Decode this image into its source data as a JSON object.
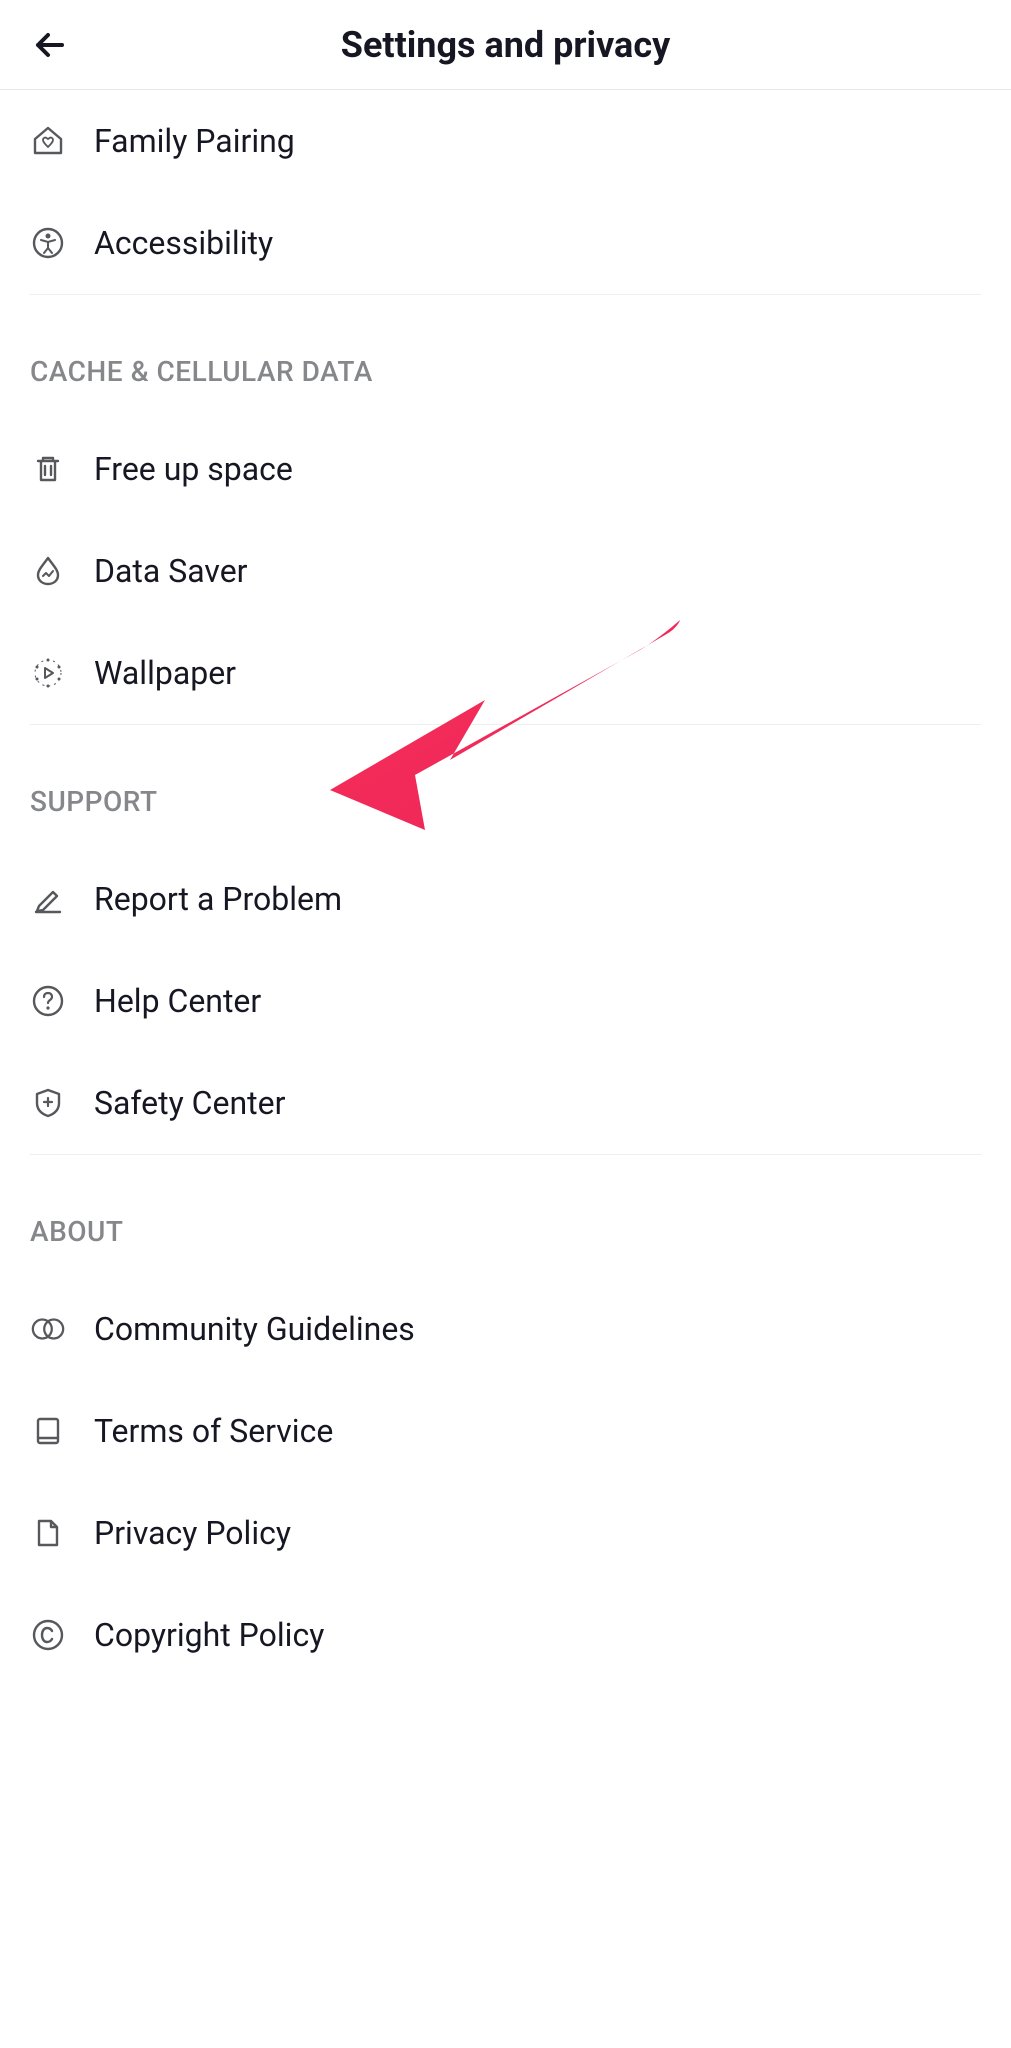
{
  "header": {
    "title": "Settings and privacy"
  },
  "sections": {
    "top": {
      "items": [
        {
          "label": "Family Pairing",
          "icon": "home-heart-icon"
        },
        {
          "label": "Accessibility",
          "icon": "accessibility-icon"
        }
      ]
    },
    "cache": {
      "title": "CACHE & CELLULAR DATA",
      "items": [
        {
          "label": "Free up space",
          "icon": "trash-icon"
        },
        {
          "label": "Data Saver",
          "icon": "water-drop-icon"
        },
        {
          "label": "Wallpaper",
          "icon": "dots-play-icon"
        }
      ]
    },
    "support": {
      "title": "SUPPORT",
      "items": [
        {
          "label": "Report a Problem",
          "icon": "pencil-icon"
        },
        {
          "label": "Help Center",
          "icon": "question-circle-icon"
        },
        {
          "label": "Safety Center",
          "icon": "shield-plus-icon"
        }
      ]
    },
    "about": {
      "title": "ABOUT",
      "items": [
        {
          "label": "Community Guidelines",
          "icon": "circles-overlap-icon"
        },
        {
          "label": "Terms of Service",
          "icon": "book-icon"
        },
        {
          "label": "Privacy Policy",
          "icon": "file-icon"
        },
        {
          "label": "Copyright Policy",
          "icon": "copyright-icon"
        }
      ]
    }
  },
  "annotation": {
    "arrow_color": "#f5305a",
    "target": "Report a Problem"
  }
}
